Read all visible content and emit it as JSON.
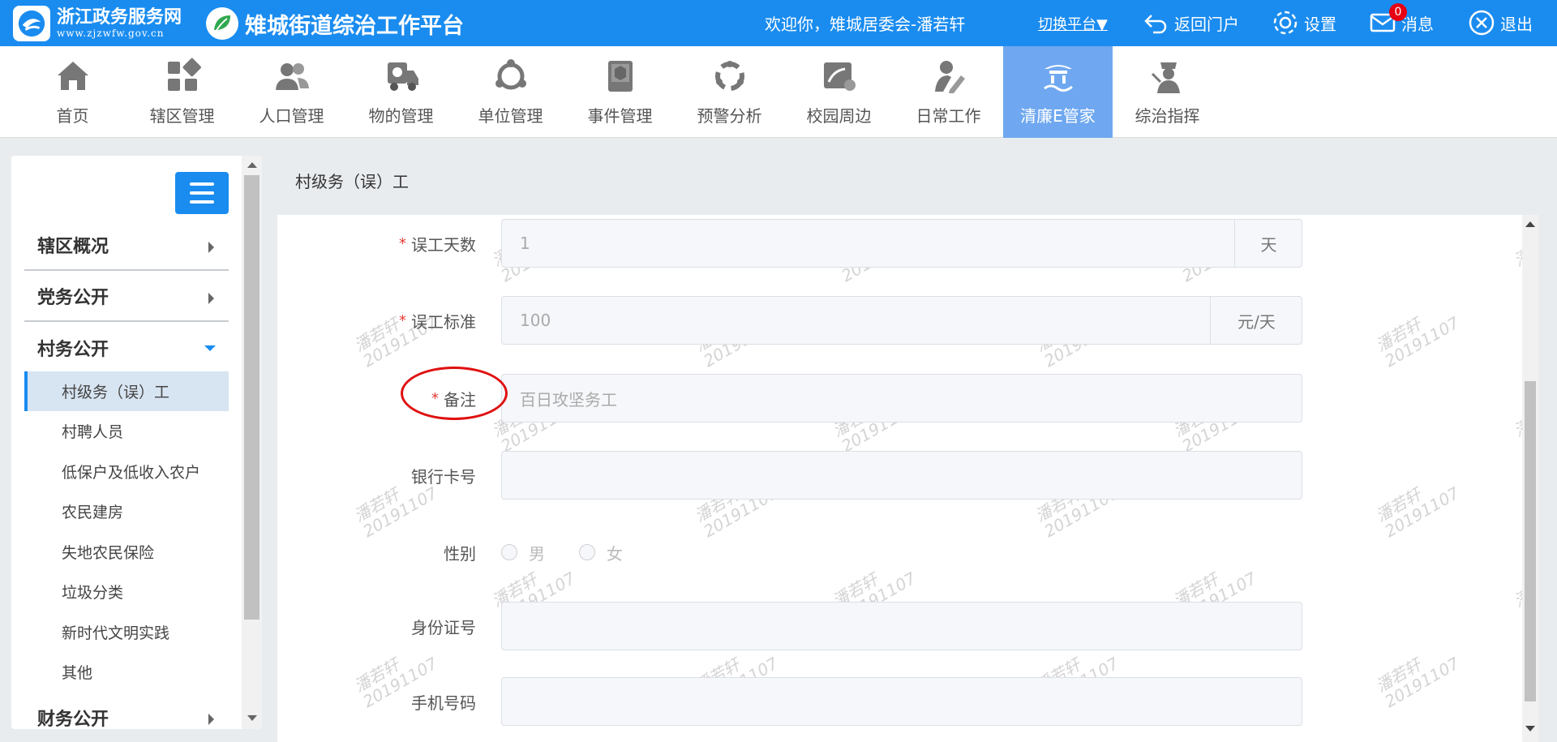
{
  "header": {
    "logo_title": "浙江政务服务网",
    "logo_url_text": "www.zjzwfw.gov.cn",
    "platform_title": "雉城街道综治工作平台",
    "welcome": "欢迎你，雉城居委会-潘若轩",
    "switch_platform": "切换平台▼",
    "back_portal": "返回门户",
    "settings": "设置",
    "messages": "消息",
    "message_count": "0",
    "logout": "退出"
  },
  "nav": {
    "items": [
      {
        "label": "首页",
        "icon": "home-icon"
      },
      {
        "label": "辖区管理",
        "icon": "grid-icon"
      },
      {
        "label": "人口管理",
        "icon": "people-icon"
      },
      {
        "label": "物的管理",
        "icon": "truck-icon"
      },
      {
        "label": "单位管理",
        "icon": "network-icon"
      },
      {
        "label": "事件管理",
        "icon": "book-icon"
      },
      {
        "label": "预警分析",
        "icon": "cycle-icon"
      },
      {
        "label": "校园周边",
        "icon": "school-icon"
      },
      {
        "label": "日常工作",
        "icon": "user-edit-icon"
      },
      {
        "label": "清廉E管家",
        "icon": "building-icon"
      },
      {
        "label": "综治指挥",
        "icon": "police-icon"
      }
    ],
    "active": "清廉E管家"
  },
  "sidebar": {
    "sections": [
      "辖区概况",
      "党务公开",
      "村务公开",
      "财务公开"
    ],
    "sub_items": [
      "村级务（误）工",
      "村聘人员",
      "低保户及低收入农户",
      "农民建房",
      "失地农民保险",
      "垃圾分类",
      "新时代文明实践",
      "其他"
    ],
    "active_sub": "村级务（误）工"
  },
  "main": {
    "breadcrumb": "村级务（误）工",
    "watermark_name": "潘若轩",
    "watermark_date": "20191107",
    "form": {
      "days_label": "误工天数",
      "days_value": "1",
      "days_suffix": "天",
      "standard_label": "误工标准",
      "standard_value": "100",
      "standard_suffix": "元/天",
      "remark_label": "备注",
      "remark_placeholder": "百日攻坚务工",
      "bank_label": "银行卡号",
      "gender_label": "性别",
      "gender_male": "男",
      "gender_female": "女",
      "id_label": "身份证号",
      "phone_label": "手机号码"
    }
  },
  "colors": {
    "primary": "#1a8cf0",
    "nav_active": "#6fa8f0",
    "required": "#e53935",
    "annotation": "#e01010"
  }
}
